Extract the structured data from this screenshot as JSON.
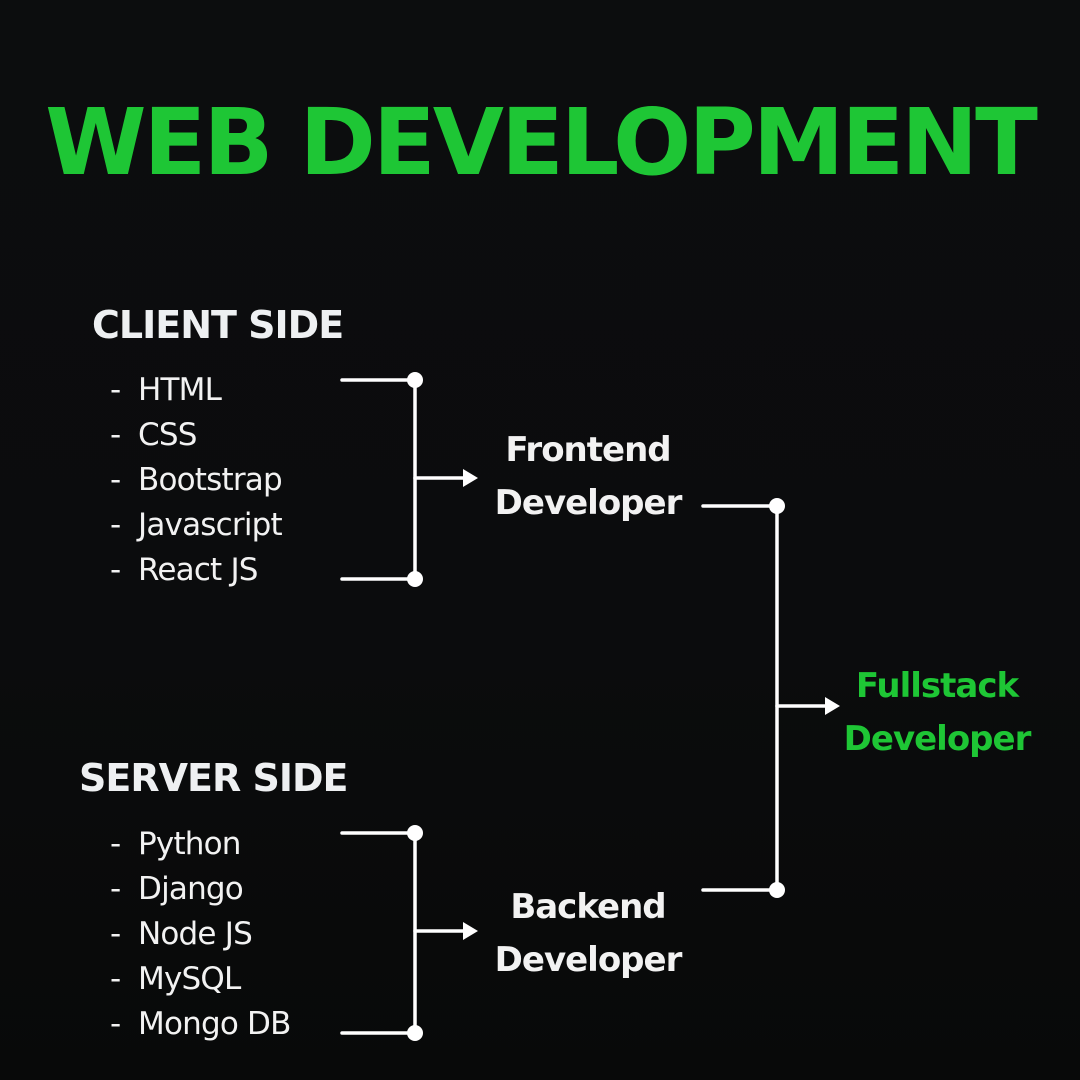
{
  "title": "WEB DEVELOPMENT",
  "client": {
    "heading": "CLIENT SIDE",
    "items": [
      "HTML",
      "CSS",
      "Bootstrap",
      "Javascript",
      "React JS"
    ]
  },
  "server": {
    "heading": "SERVER SIDE",
    "items": [
      "Python",
      "Django",
      "Node JS",
      "MySQL",
      "Mongo DB"
    ]
  },
  "frontend": {
    "line1": "Frontend",
    "line2": "Developer"
  },
  "backend": {
    "line1": "Backend",
    "line2": "Developer"
  },
  "fullstack": {
    "line1": "Fullstack",
    "line2": "Developer"
  },
  "list_dash": "-",
  "colors": {
    "accent": "#1ec635",
    "text": "#f2f2f2",
    "connector": "#ffffff",
    "background": "#0b0c0d"
  }
}
